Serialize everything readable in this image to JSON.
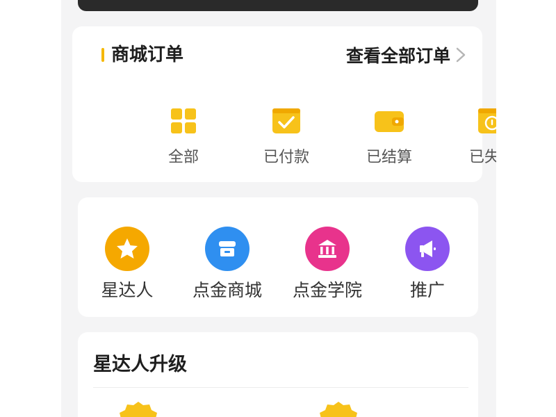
{
  "orders": {
    "title": "商城订单",
    "view_all": "查看全部订单",
    "items": [
      {
        "label": "全部",
        "icon": "grid-icon"
      },
      {
        "label": "已付款",
        "icon": "paid-check-icon"
      },
      {
        "label": "已结算",
        "icon": "wallet-icon"
      },
      {
        "label": "已失效",
        "icon": "expired-info-icon"
      }
    ]
  },
  "tools": {
    "items": [
      {
        "label": "星达人",
        "icon": "star-icon",
        "color": "#f5a800"
      },
      {
        "label": "点金商城",
        "icon": "store-icon",
        "color": "#2f8ff0"
      },
      {
        "label": "点金学院",
        "icon": "bank-icon",
        "color": "#e8338c"
      },
      {
        "label": "推广",
        "icon": "megaphone-icon",
        "color": "#8c55f0"
      }
    ]
  },
  "upgrade": {
    "title": "星达人升级"
  },
  "colors": {
    "accent": "#f5b800",
    "icon_yellow": "#f7c21a"
  }
}
